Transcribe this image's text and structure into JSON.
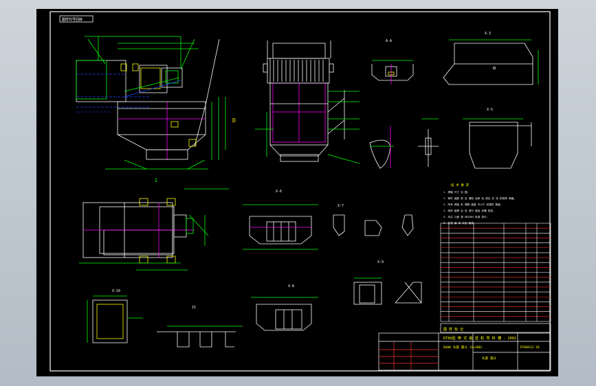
{
  "viewer": {
    "bg_top": "#cdd4da",
    "bg_bottom": "#b3bcc6"
  },
  "sheet": {
    "ref_tag": "图样代号回转",
    "section_labels": {
      "a": "A-A",
      "b": "X-3",
      "c": "X-5",
      "d": "X-6",
      "e": "X-7",
      "f": "X-8",
      "g": "X-9",
      "h": "X-10"
    },
    "view_labels": {
      "detail_i": "I",
      "detail_ii": "II",
      "detail_d": "D"
    },
    "notes_title": "技 术 要 求",
    "notes": [
      "1. 焊缝 尺寸 见 图。",
      "2. 零件 装配 前 应 清除 毛刺 及 锐边 并 涂 防锈漆 两遍。",
      "3. 所有 焊接 处 焊脚 高度 不小于 较薄件 厚度。",
      "4. 壳体 组焊 后 应 进行 煤油 渗漏 检查。",
      "5. 未注 公差 按 GB1804 标准 执行。",
      "6. 外表 面 涂 灰色 面漆。"
    ],
    "title_block": {
      "main_title": "DT8A型 带 式 输 送 机 导 料 槽 - 2002",
      "sub_title": "B400 头部 漏斗 (H=300)",
      "drawing_no": "DT08A12-1D",
      "name_row": "头部 漏斗",
      "stamp": "图 样 标 记"
    },
    "bom_rows": 20
  },
  "colors": {
    "paper": "#000000",
    "line": "#ffffff",
    "green": "#00ff00",
    "yellow": "#ffff00",
    "magenta": "#ff00ff",
    "blue": "#2040ff",
    "cyan": "#00ffff",
    "red": "#ff3030"
  }
}
